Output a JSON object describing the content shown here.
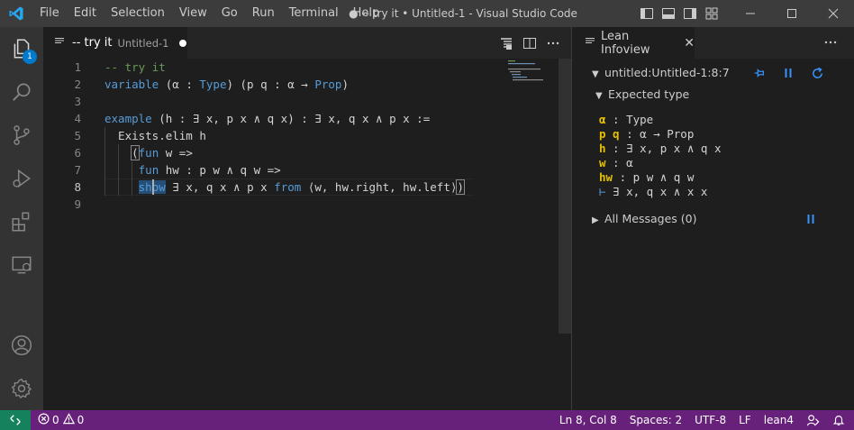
{
  "window": {
    "title": "● -- try it • Untitled-1 - Visual Studio Code",
    "menu": [
      "File",
      "Edit",
      "Selection",
      "View",
      "Go",
      "Run",
      "Terminal",
      "Help"
    ]
  },
  "activity_bar": {
    "items": [
      "explorer-icon",
      "search-icon",
      "source-control-icon",
      "run-debug-icon",
      "extensions-icon",
      "remote-explorer-icon"
    ],
    "explorer_badge": "1",
    "bottom": [
      "account-icon",
      "settings-gear-icon"
    ]
  },
  "editor": {
    "tab": {
      "label": "-- try it",
      "description": "Untitled-1"
    },
    "line_numbers": [
      "1",
      "2",
      "3",
      "4",
      "5",
      "6",
      "7",
      "8",
      "9"
    ],
    "active_line": 8,
    "code": {
      "l1": "-- try it",
      "l2_kw": "variable",
      "l2_a": " (α : ",
      "l2_type": "Type",
      "l2_b": ") (p q : α → ",
      "l2_prop": "Prop",
      "l2_c": ")",
      "l4_kw": "example",
      "l4_rest": " (h : ∃ x, p x ∧ q x) : ∃ x, q x ∧ p x :=",
      "l5": "  Exists.elim h",
      "l6_pad": "    ",
      "l6_paren": "(",
      "l6_kw": "fun",
      "l6_rest": " w =>",
      "l7_pad": "     ",
      "l7_kw": "fun",
      "l7_rest": " hw : p w ∧ q w =>",
      "l8_pad": "     ",
      "l8_sel1": "sh",
      "l8_sel2": "ow",
      "l8_mid": " ∃ x, q x ∧ p x ",
      "l8_kw": "from",
      "l8_rest": " ⟨w, hw.right, hw.left⟩",
      "l8_paren": ")"
    }
  },
  "infoview": {
    "tab_label": "Lean Infoview",
    "position": "untitled:Untitled-1:8:7",
    "expected_type_label": "Expected type",
    "goal": {
      "h1_name": "α",
      "h1_sep": " : ",
      "h1_type": "Type",
      "h2_name": "p q",
      "h2_sep": " : ",
      "h2_type": "α → Prop",
      "h3_name": "h",
      "h3_sep": " : ",
      "h3_type": "∃ x, p x ∧ q x",
      "h4_name": "w",
      "h4_sep": " : ",
      "h4_type": "α",
      "h5_name": "hw",
      "h5_sep": " : ",
      "h5_type": "p w ∧ q w",
      "turnstile": "⊢",
      "target": " ∃ x, q x ∧ x x"
    },
    "all_messages": "All Messages (0)"
  },
  "status_bar": {
    "errors": "0",
    "warnings": "0",
    "position": "Ln 8, Col 8",
    "spaces": "Spaces: 2",
    "encoding": "UTF-8",
    "eol": "LF",
    "language": "lean4"
  },
  "colors": {
    "status_bar": "#68217a",
    "remote": "#16825d",
    "accent": "#007acc",
    "hypothesis": "#e5c100"
  }
}
